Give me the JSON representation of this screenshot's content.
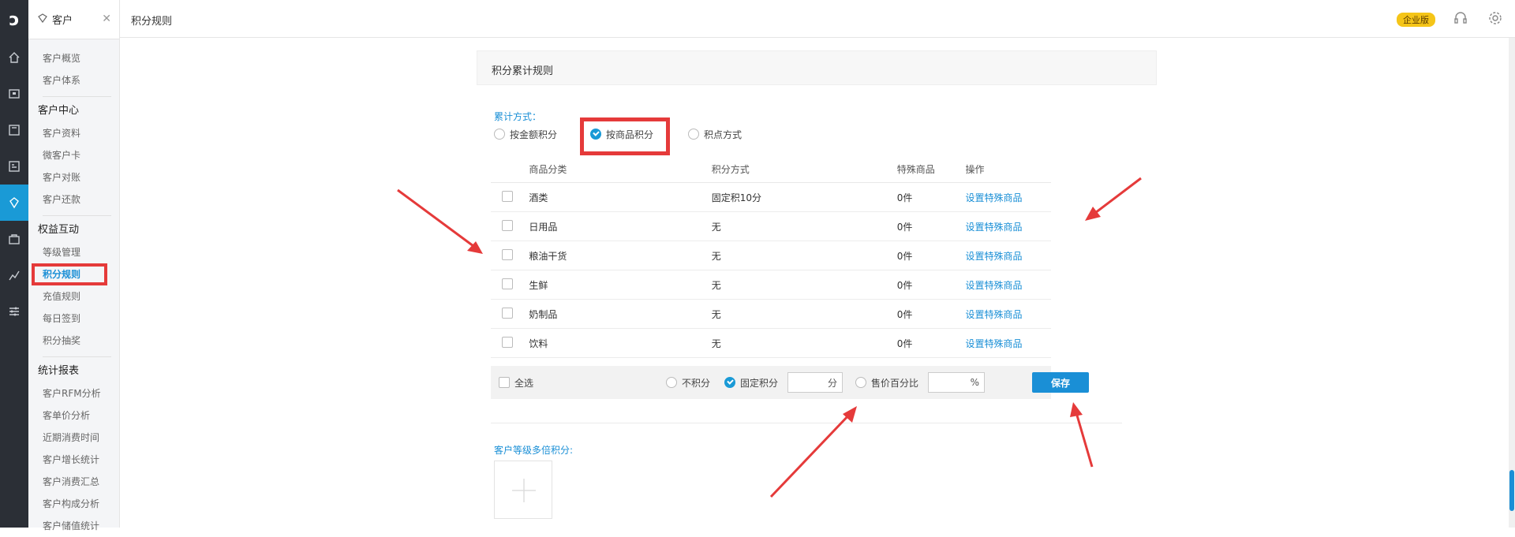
{
  "app": {
    "logo": "ↄ"
  },
  "sidebar": {
    "header": "客户",
    "groups": [
      {
        "title": "",
        "items": [
          "客户概览",
          "客户体系"
        ]
      },
      {
        "title": "客户中心",
        "items": [
          "客户资料",
          "微客户卡",
          "客户对账",
          "客户还款"
        ]
      },
      {
        "title": "权益互动",
        "items": [
          "等级管理",
          "积分规则",
          "充值规则",
          "每日签到",
          "积分抽奖"
        ]
      },
      {
        "title": "统计报表",
        "items": [
          "客户RFM分析",
          "客单价分析",
          "近期消费时间",
          "客户增长统计",
          "客户消费汇总",
          "客户构成分析",
          "客户储值统计"
        ]
      }
    ],
    "active_item": "积分规则"
  },
  "topbar": {
    "title": "积分规则",
    "badge": "企业版"
  },
  "panel": {
    "title": "积分累计规则",
    "accum_label": "累计方式：",
    "accum_options": [
      "按金额积分",
      "按商品积分",
      "积点方式"
    ],
    "accum_selected": "按商品积分"
  },
  "table": {
    "headers": [
      "商品分类",
      "积分方式",
      "特殊商品",
      "操作"
    ],
    "rows": [
      {
        "category": "酒类",
        "method": "固定积10分",
        "special": "0件",
        "action": "设置特殊商品"
      },
      {
        "category": "日用品",
        "method": "无",
        "special": "0件",
        "action": "设置特殊商品"
      },
      {
        "category": "粮油干货",
        "method": "无",
        "special": "0件",
        "action": "设置特殊商品"
      },
      {
        "category": "生鲜",
        "method": "无",
        "special": "0件",
        "action": "设置特殊商品"
      },
      {
        "category": "奶制品",
        "method": "无",
        "special": "0件",
        "action": "设置特殊商品"
      },
      {
        "category": "饮料",
        "method": "无",
        "special": "0件",
        "action": "设置特殊商品"
      }
    ]
  },
  "footer": {
    "select_all": "全选",
    "opt_none": "不积分",
    "opt_fixed": "固定积分",
    "fixed_unit": "分",
    "opt_percent": "售价百分比",
    "percent_unit": "%",
    "save": "保存"
  },
  "tier": {
    "label": "客户等级多倍积分:",
    "add_symbol": "+"
  },
  "colors": {
    "accent": "#1a8fd6",
    "annotation": "#e53a3a",
    "badge": "#f5c518"
  }
}
